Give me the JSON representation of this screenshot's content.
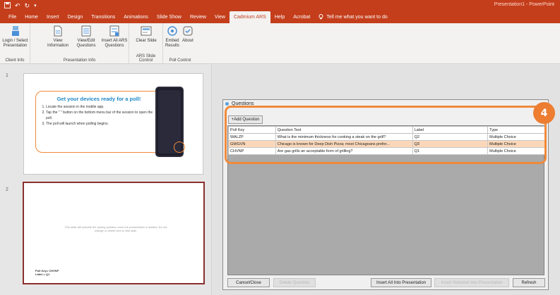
{
  "titlebar": {
    "title": "Presentation1 - PowerPoint"
  },
  "tabs": [
    {
      "label": "File"
    },
    {
      "label": "Home"
    },
    {
      "label": "Insert"
    },
    {
      "label": "Design"
    },
    {
      "label": "Transitions"
    },
    {
      "label": "Animations"
    },
    {
      "label": "Slide Show"
    },
    {
      "label": "Review"
    },
    {
      "label": "View"
    },
    {
      "label": "Cadmium ARS",
      "active": true
    },
    {
      "label": "Help"
    },
    {
      "label": "Acrobat"
    }
  ],
  "tell_me": "Tell me what you want to do",
  "ribbon": {
    "groups": {
      "client_info": "Client Info",
      "presentation_info": "Presentation Info",
      "slide_control": "ARS Slide Control",
      "poll_control": "Poll Control"
    },
    "buttons": {
      "login": "Login / Select Presentation",
      "view_info": "View Information",
      "view_edit": "View/Edit Questions",
      "insert_all": "Insert All ARS Questions",
      "clear_slide": "Clear Slide",
      "embed_results": "Embed Results",
      "about": "About"
    }
  },
  "slides": {
    "slide1_number": "1",
    "slide2_number": "2",
    "slide1": {
      "heading": "Get your devices ready for a poll!",
      "steps": [
        "Locate the session in the mobile app.",
        "Tap the \" \" button on the bottom menu bar of the session to open the poll.",
        "The poll will launch when polling begins."
      ]
    },
    "slide2": {
      "notice": "This slide will activate the polling question once the presentation is started. Do not change or delete text on this slide.",
      "poll_key": "Poll Key= CHVNP",
      "label": "Label = Q1"
    }
  },
  "dialog": {
    "title": "Questions",
    "add_button": "+Add Question",
    "columns": [
      "Poll Key",
      "Question Text",
      "Label",
      "Type"
    ],
    "rows": [
      [
        "WALZP",
        "What is the minimum thickness for cooking a steak on the grill?",
        "Q2",
        "Multiple Choice"
      ],
      [
        "GWGVN",
        "Chicago is known for Deep Dish Pizza; most Chicagoans prefer...",
        "Q3",
        "Multiple Choice"
      ],
      [
        "CHVNP",
        "Are gas grills an acceptable form of grilling?",
        "Q1",
        "Multiple Choice"
      ]
    ],
    "selected_row": 1,
    "buttons": {
      "cancel": "Cancel/Close",
      "delete": "Delete Question",
      "insert_all": "Insert All Into Presentation",
      "insert_selected": "Insert Selected Into Presentation",
      "refresh": "Refresh"
    }
  },
  "badge": "4",
  "colors": {
    "brand": "#c43e1c",
    "accent": "#ed7d31",
    "selected_row": "#fad7b9"
  }
}
